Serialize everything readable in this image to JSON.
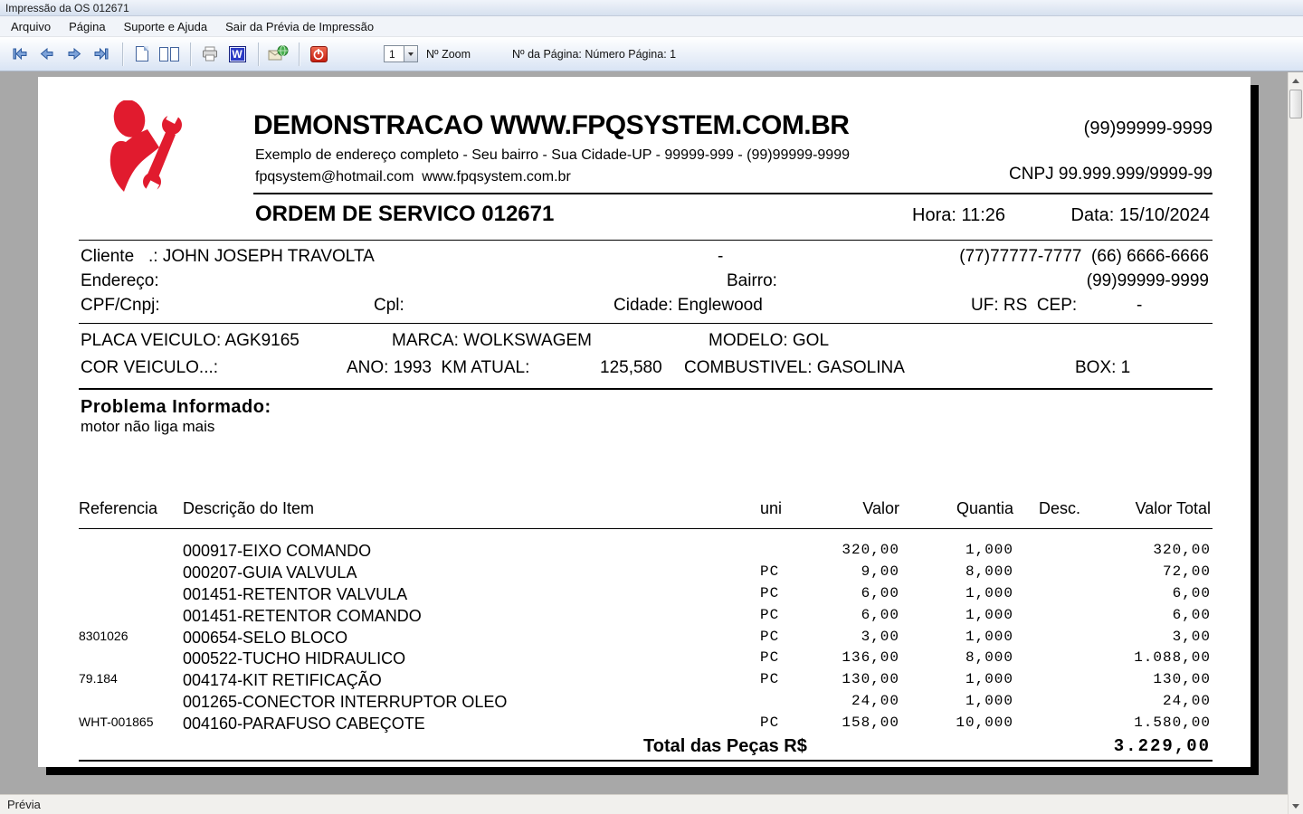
{
  "window": {
    "title": "Impressão da OS 012671"
  },
  "menu": {
    "items": [
      {
        "label": "Arquivo"
      },
      {
        "label": "Página"
      },
      {
        "label": "Suporte e Ajuda"
      },
      {
        "label": "Sair da Prévia de Impressão"
      }
    ]
  },
  "toolbar": {
    "zoom_value": "1",
    "zoom_label": "Nº Zoom",
    "page_info": "Nº da Página: Número Página: 1",
    "word_icon_text": "W"
  },
  "statusbar": {
    "text": "Prévia"
  },
  "colors": {
    "logo_red": "#e11b2e",
    "word_icon_blue": "#2b3bc4",
    "power_icon_red": "#c41f10",
    "nav_arrow_blue": "#7da2d8"
  },
  "doc": {
    "company": {
      "name": "DEMONSTRACAO WWW.FPQSYSTEM.COM.BR",
      "phone": "(99)99999-9999",
      "address": "Exemplo de endereço completo - Seu bairro - Sua Cidade-UP - 99999-999 - (99)99999-9999",
      "email_web": "fpqsystem@hotmail.com  www.fpqsystem.com.br",
      "cnpj": "CNPJ 99.999.999/9999-99"
    },
    "order": {
      "title": "ORDEM DE SERVICO 012671",
      "hora": "Hora: 11:26",
      "data": "Data: 15/10/2024"
    },
    "client": {
      "row1_left": "Cliente   .: JOHN JOSEPH TRAVOLTA",
      "row1_dash": "-",
      "row1_phones": "(77)77777-7777  (66) 6666-6666",
      "row2_endereco": "Endereço:",
      "row2_bairro": "Bairro:",
      "row2_phone": "(99)99999-9999",
      "row3_cpf": "CPF/Cnpj:",
      "row3_cpl": "Cpl:",
      "row3_cidade": "Cidade: Englewood",
      "row3_ufcep": "UF: RS  CEP:",
      "row3_cep_value": "-"
    },
    "vehicle": {
      "placa": "PLACA VEICULO: AGK9165",
      "marca": "MARCA: WOLKSWAGEM",
      "modelo": "MODELO: GOL",
      "cor": "COR VEICULO...:",
      "ano_km": "ANO: 1993  KM ATUAL:",
      "km_value": "125,580",
      "combustivel": "COMBUSTIVEL: GASOLINA",
      "box": "BOX: 1"
    },
    "problem": {
      "label": "Problema Informado:",
      "text": "motor não liga mais"
    },
    "items_table": {
      "headers": {
        "ref": "Referencia",
        "desc": "Descrição do Item",
        "uni": "uni",
        "valor": "Valor",
        "quantia": "Quantia",
        "desconto": "Desc.",
        "total": "Valor Total"
      },
      "rows": [
        {
          "ref": "",
          "desc": "000917-EIXO COMANDO",
          "uni": "",
          "valor": "320,00",
          "quantia": "1,000",
          "desconto": "",
          "total": "320,00"
        },
        {
          "ref": "",
          "desc": "000207-GUIA VALVULA",
          "uni": "PC",
          "valor": "9,00",
          "quantia": "8,000",
          "desconto": "",
          "total": "72,00"
        },
        {
          "ref": "",
          "desc": "001451-RETENTOR VALVULA",
          "uni": "PC",
          "valor": "6,00",
          "quantia": "1,000",
          "desconto": "",
          "total": "6,00"
        },
        {
          "ref": "",
          "desc": "001451-RETENTOR COMANDO",
          "uni": "PC",
          "valor": "6,00",
          "quantia": "1,000",
          "desconto": "",
          "total": "6,00"
        },
        {
          "ref": "8301026",
          "desc": "000654-SELO BLOCO",
          "uni": "PC",
          "valor": "3,00",
          "quantia": "1,000",
          "desconto": "",
          "total": "3,00"
        },
        {
          "ref": "",
          "desc": "000522-TUCHO HIDRAULICO",
          "uni": "PC",
          "valor": "136,00",
          "quantia": "8,000",
          "desconto": "",
          "total": "1.088,00"
        },
        {
          "ref": "79.184",
          "desc": "004174-KIT RETIFICAÇÃO",
          "uni": "PC",
          "valor": "130,00",
          "quantia": "1,000",
          "desconto": "",
          "total": "130,00"
        },
        {
          "ref": "",
          "desc": "001265-CONECTOR INTERRUPTOR OLEO",
          "uni": "",
          "valor": "24,00",
          "quantia": "1,000",
          "desconto": "",
          "total": "24,00"
        },
        {
          "ref": "WHT-001865",
          "desc": "004160-PARAFUSO CABEÇOTE",
          "uni": "PC",
          "valor": "158,00",
          "quantia": "10,000",
          "desconto": "",
          "total": "1.580,00"
        }
      ],
      "total_label": "Total das Peças R$",
      "total_value": "3.229,00"
    }
  }
}
